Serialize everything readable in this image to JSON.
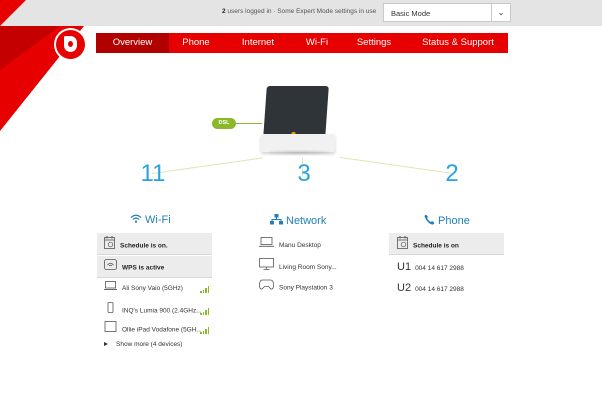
{
  "topbar": {
    "users_count": "2",
    "users_text": " users logged in",
    "expert_text": "Some Expert Mode settings in use",
    "mode_value": "Basic Mode"
  },
  "nav": {
    "items": [
      {
        "label": "Overview",
        "active": true
      },
      {
        "label": "Phone",
        "active": false
      },
      {
        "label": "Internet",
        "active": false
      },
      {
        "label": "Wi-Fi",
        "active": false
      },
      {
        "label": "Settings",
        "active": false
      },
      {
        "label": "Status & Support",
        "active": false
      }
    ]
  },
  "router": {
    "dsl_label": "DSL"
  },
  "wifi": {
    "count": "11",
    "title": "Wi-Fi",
    "schedule": "Schedule is on.",
    "wps": "WPS is active",
    "devices": [
      {
        "name": "Ali Sony Vaio (5GHz)",
        "icon": "laptop-icon"
      },
      {
        "name": "INQ's Lumia 900 (2.4GHz...",
        "icon": "phone-icon"
      },
      {
        "name": "Ollie iPad Vodafone (5GH...",
        "icon": "tablet-icon"
      }
    ],
    "more": "Show more (4 devices)"
  },
  "network": {
    "count": "3",
    "title": "Network",
    "devices": [
      {
        "name": "Manu Desktop",
        "icon": "laptop-icon"
      },
      {
        "name": "Living Room Sony...",
        "icon": "tv-icon"
      },
      {
        "name": "Sony Playstation 3",
        "icon": "gamepad-icon"
      }
    ]
  },
  "phone": {
    "count": "2",
    "title": "Phone",
    "schedule": "Schedule is on",
    "lines": [
      {
        "label": "U1",
        "number": "004 14 617 2988"
      },
      {
        "label": "U2",
        "number": "004 14 617 2988"
      }
    ]
  },
  "colors": {
    "brand_red": "#e60000",
    "accent_blue": "#29a3e0",
    "signal_green": "#8bb82a"
  }
}
